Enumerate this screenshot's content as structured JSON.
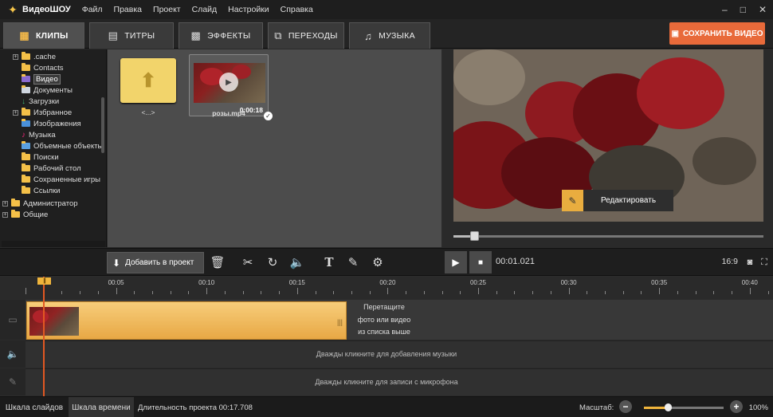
{
  "app": {
    "name": "ВидеоШОУ",
    "window_controls": [
      "–",
      "□",
      "✕"
    ]
  },
  "menu": [
    "Файл",
    "Правка",
    "Проект",
    "Слайд",
    "Настройки",
    "Справка"
  ],
  "tabs": [
    {
      "label": "КЛИПЫ",
      "icon": "film-icon",
      "active": true
    },
    {
      "label": "ТИТРЫ",
      "icon": "titles-icon",
      "active": false
    },
    {
      "label": "ЭФФЕКТЫ",
      "icon": "effects-icon",
      "active": false
    },
    {
      "label": "ПЕРЕХОДЫ",
      "icon": "transitions-icon",
      "active": false
    },
    {
      "label": "МУЗЫКА",
      "icon": "music-note-icon",
      "active": false
    }
  ],
  "save_button": "СОХРАНИТЬ ВИДЕО",
  "tree": [
    ".cache",
    "Contacts",
    "Видео",
    "Документы",
    "Загрузки",
    "Избранное",
    "Изображения",
    "Музыка",
    "Объемные объекты",
    "Поиски",
    "Рабочий стол",
    "Сохраненные игры",
    "Ссылки",
    "Администратор",
    "Общие"
  ],
  "files": {
    "up_label": "<...>",
    "video_name": "розы.mp4",
    "video_duration": "0:00:18"
  },
  "preview": {
    "edit_label": "Редактировать",
    "progress": 0.06
  },
  "toolbar": {
    "add_label": "Добавить в проект",
    "timecode": "00:01.021",
    "aspect": "16:9"
  },
  "ruler": [
    "00:05",
    "00:10",
    "00:15",
    "00:20",
    "00:25",
    "00:30",
    "00:35",
    "00:40"
  ],
  "timeline": {
    "drop_hint": [
      "Перетащите",
      "фото или видео",
      "из списка выше"
    ],
    "music_hint": "Дважды кликните для добавления музыки",
    "mic_hint": "Дважды кликните для записи с микрофона"
  },
  "status": {
    "tab_slides": "Шкала слайдов",
    "tab_timeline": "Шкала времени",
    "duration": "Длительность проекта 00:17.708",
    "zoom_label": "Масштаб:",
    "zoom_pct": "100%",
    "zoom_level": 0.3
  },
  "colors": {
    "accent": "#f0b53c",
    "save": "#e86a3a",
    "playhead": "#e25822"
  }
}
